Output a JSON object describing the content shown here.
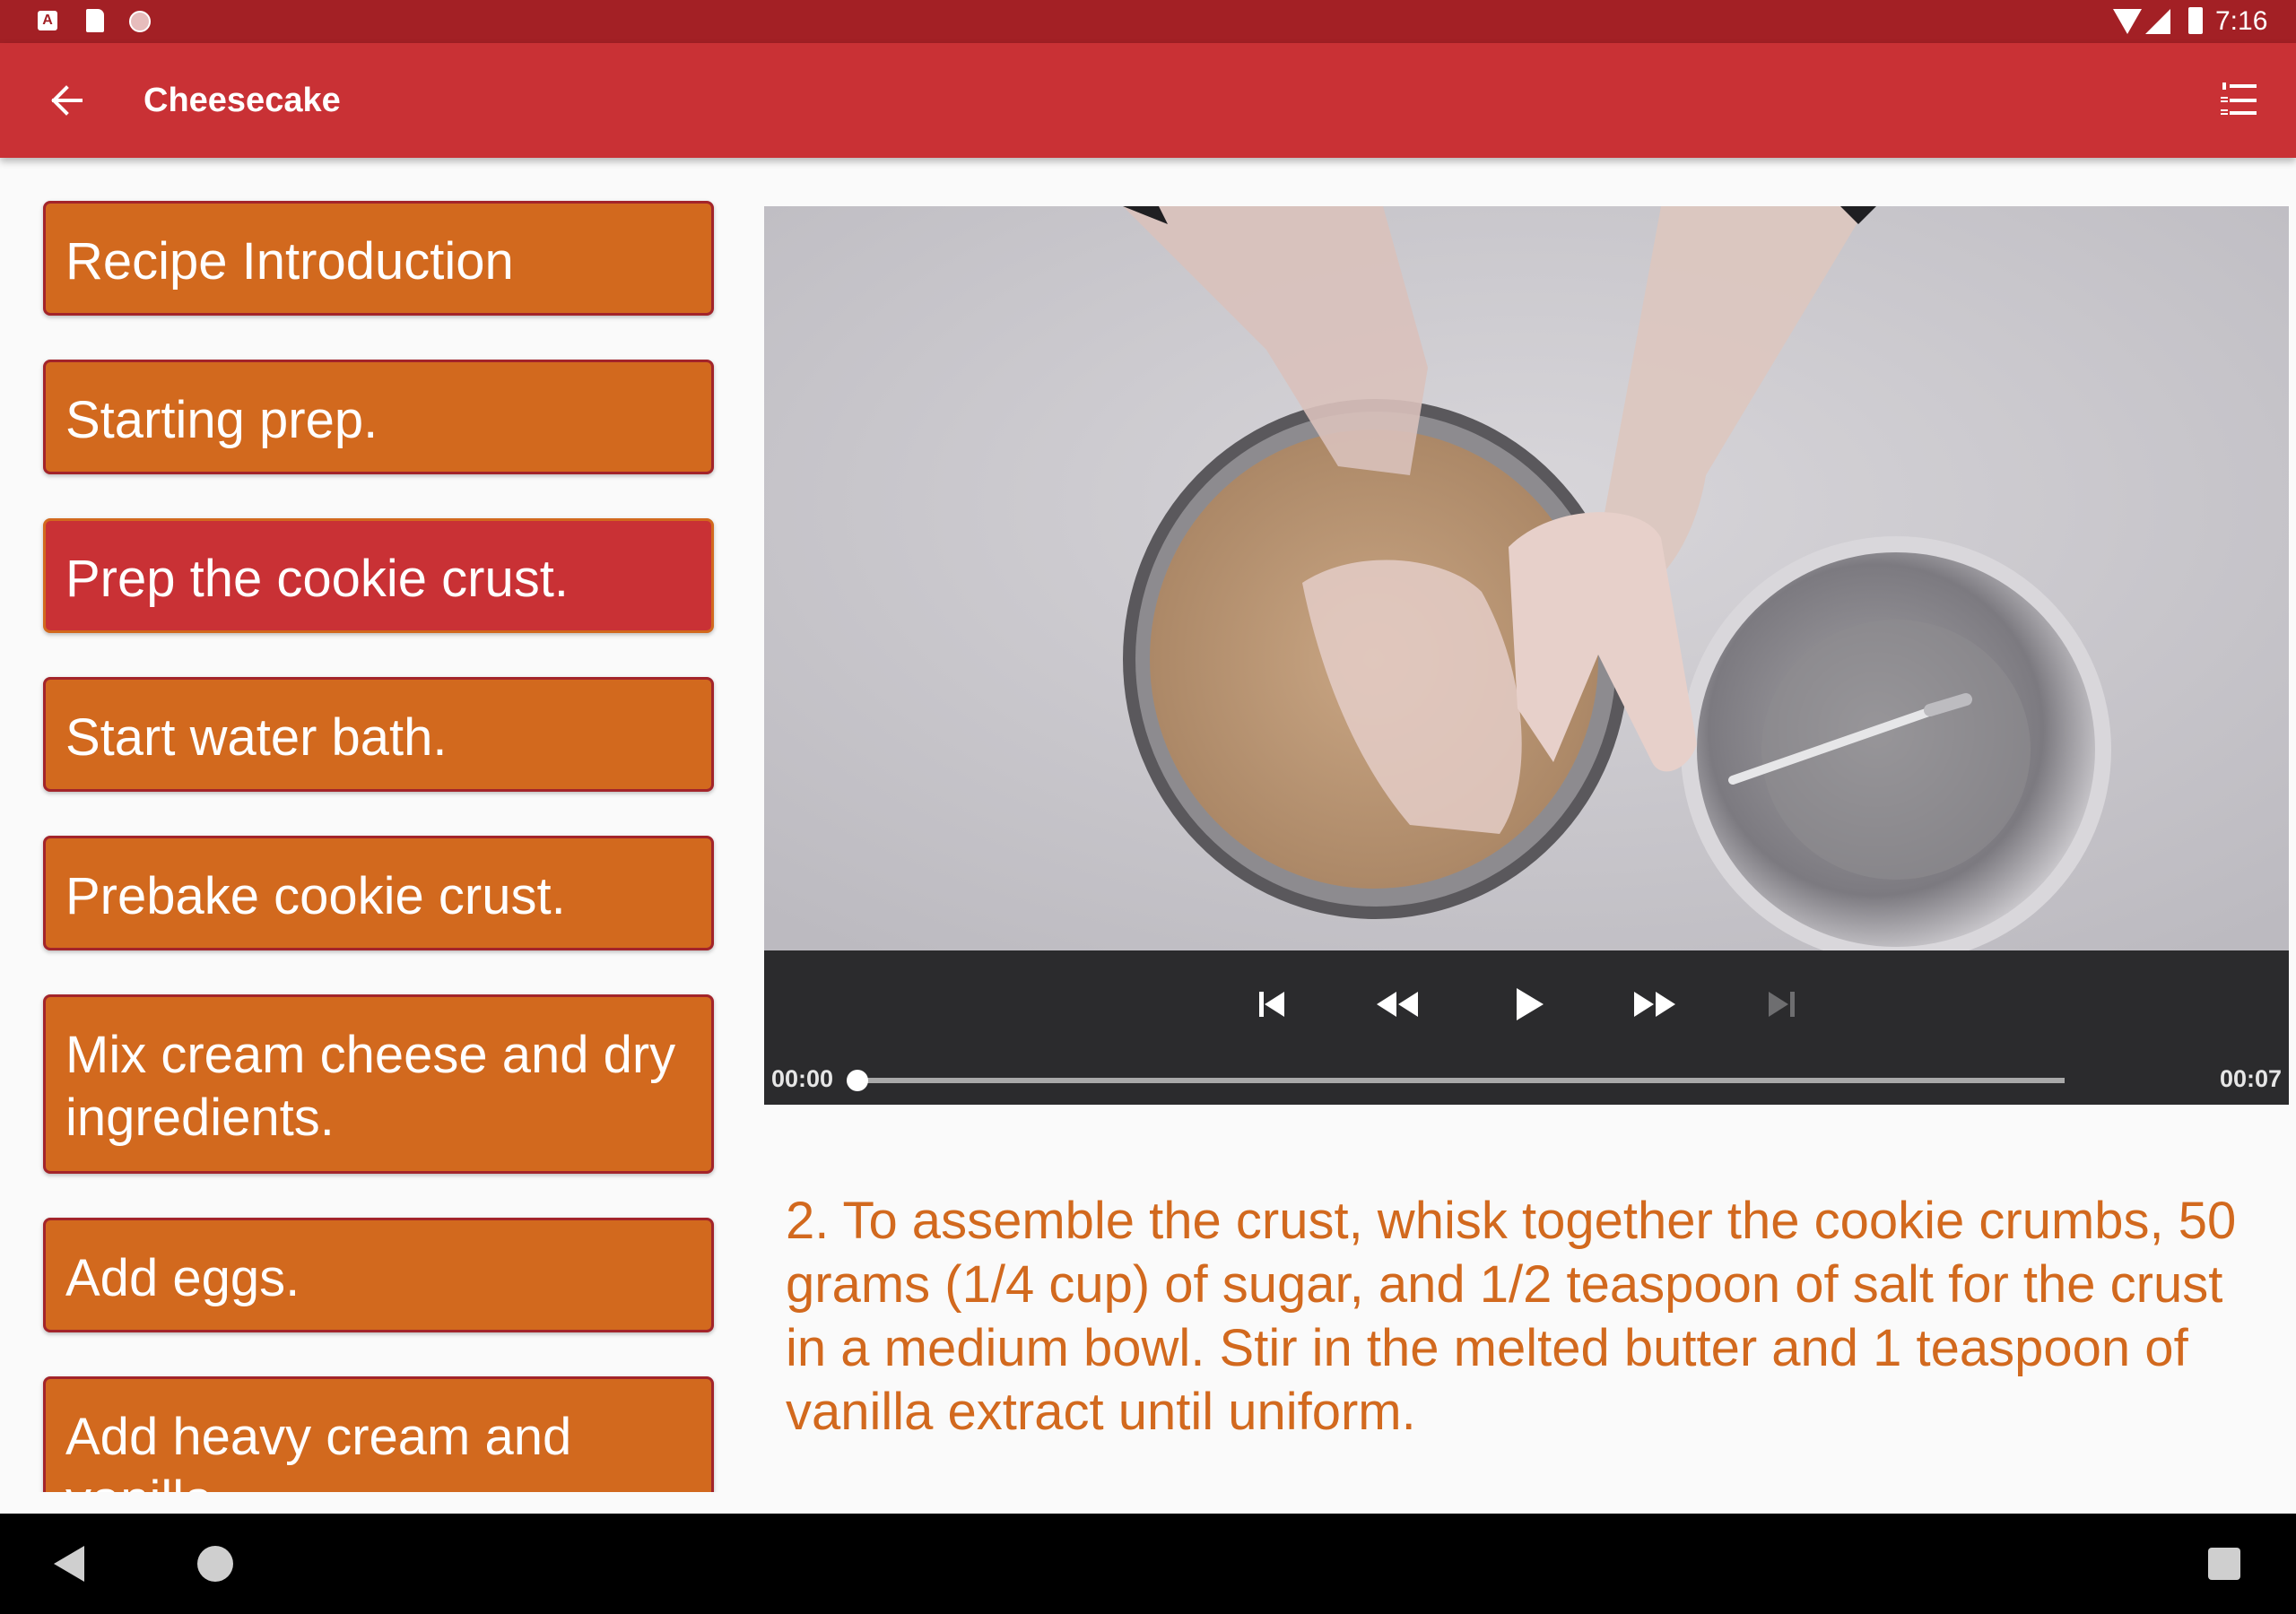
{
  "status_bar": {
    "time": "7:16",
    "left_icons": [
      "a-notification-icon",
      "sd-card-icon",
      "recording-icon"
    ],
    "right_icons": [
      "wifi-icon",
      "cell-signal-icon",
      "battery-icon"
    ],
    "a_glyph": "A"
  },
  "app_bar": {
    "title": "Cheesecake",
    "back_icon": "arrow-back-icon",
    "menu_icon": "format-list-numbered-icon"
  },
  "colors": {
    "primary": "#c93135",
    "primary_dark": "#a32025",
    "accent": "#d2691e"
  },
  "steps": [
    {
      "label": "Recipe Introduction",
      "active": false
    },
    {
      "label": "Starting prep.",
      "active": false
    },
    {
      "label": "Prep the cookie crust.",
      "active": true
    },
    {
      "label": "Start water bath.",
      "active": false
    },
    {
      "label": "Prebake cookie crust.",
      "active": false
    },
    {
      "label": "Mix cream cheese and dry ingredients.",
      "active": false
    },
    {
      "label": "Add eggs.",
      "active": false
    },
    {
      "label": "Add heavy cream and vanilla.",
      "active": false
    }
  ],
  "player": {
    "current_time": "00:00",
    "duration": "00:07",
    "progress": 0.0,
    "controls": [
      "skip-previous-icon",
      "rewind-icon",
      "play-icon",
      "fast-forward-icon",
      "skip-next-icon"
    ]
  },
  "description": "2. To assemble the crust, whisk together the cookie crumbs, 50 grams (1/4 cup) of sugar, and 1/2 teaspoon of salt for the crust in a medium bowl. Stir in the melted butter and 1 teaspoon of vanilla extract until uniform.",
  "nav_bar": {
    "icons": [
      "nav-back-icon",
      "nav-home-icon",
      "nav-recents-icon"
    ]
  }
}
